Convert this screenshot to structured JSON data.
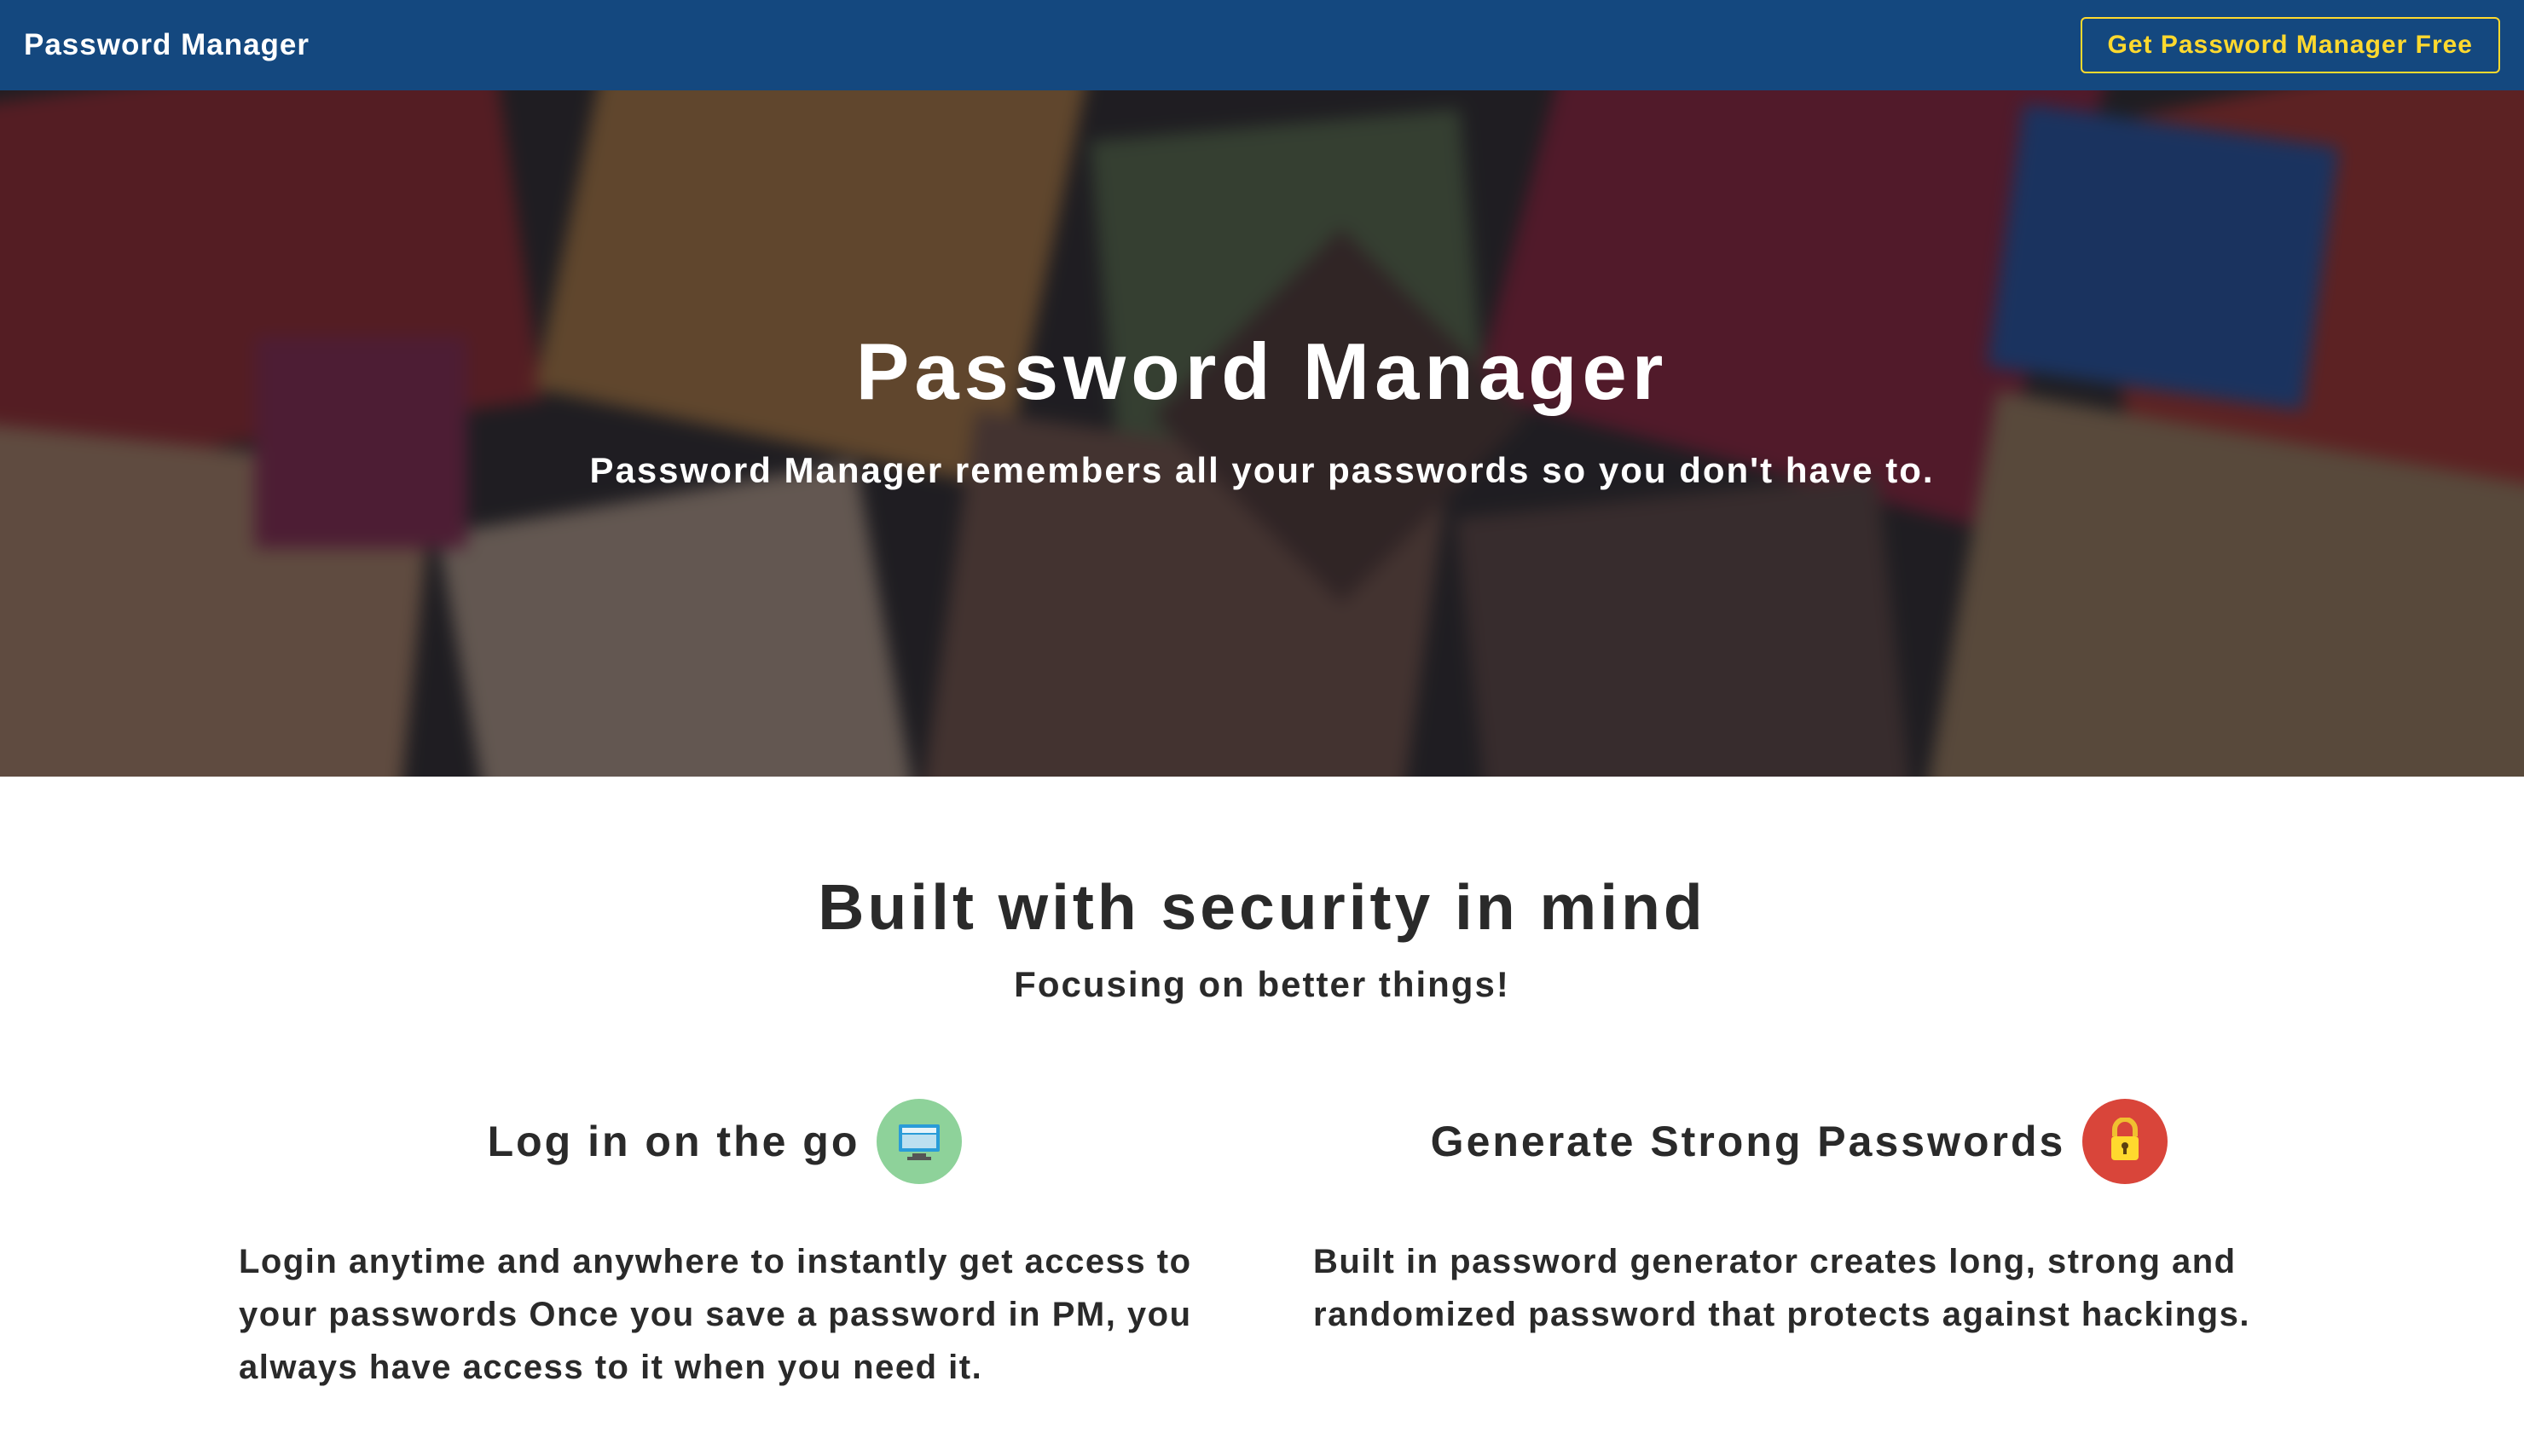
{
  "header": {
    "brand": "Password Manager",
    "cta": "Get Password Manager Free"
  },
  "hero": {
    "title": "Password Manager",
    "subtitle": "Password Manager remembers all your passwords so you don't have to."
  },
  "section": {
    "title": "Built with security in mind",
    "subtitle": "Focusing on better things!"
  },
  "features": [
    {
      "title": "Log in on the go",
      "icon": "monitor-icon",
      "desc": "Login anytime and anywhere to instantly get access to your passwords Once you save a password in PM, you always have access to it when you need it."
    },
    {
      "title": "Generate Strong Passwords",
      "icon": "lock-icon",
      "desc": "Built in password generator creates long, strong and randomized password that protects against hackings."
    }
  ]
}
